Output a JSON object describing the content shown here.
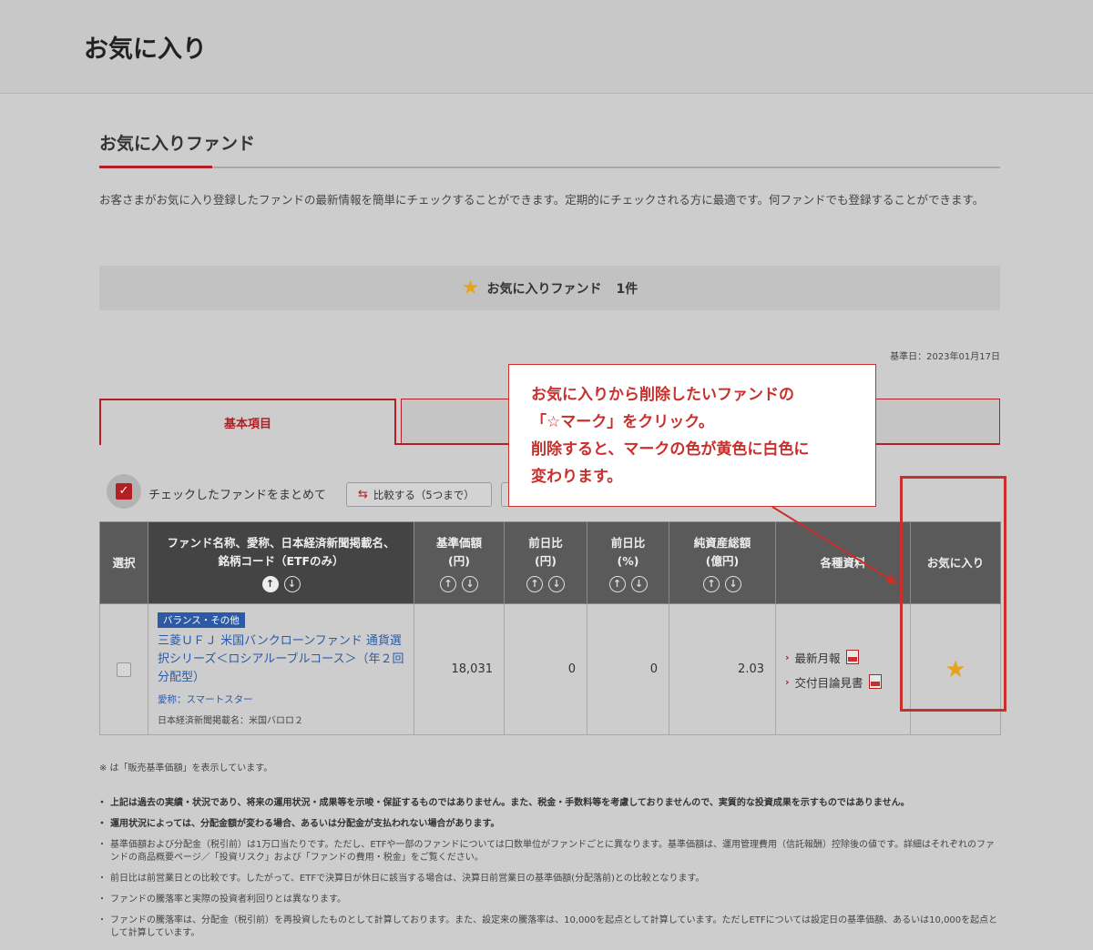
{
  "page": {
    "title": "お気に入り"
  },
  "section": {
    "title": "お気に入りファンド",
    "description": "お客さまがお気に入り登録したファンドの最新情報を簡単にチェックすることができます。定期的にチェックされる方に最適です。何ファンドでも登録することができます。"
  },
  "banner": {
    "label": "お気に入りファンド",
    "count": "1件",
    "icon": "star-icon",
    "star_color": "#e9a21c"
  },
  "base_date": "基準日：2023年01月17日",
  "tabs": [
    {
      "label": "基本項目",
      "active": true
    },
    {
      "label": "",
      "active": false
    }
  ],
  "actions": {
    "check_label": "チェックしたファンドをまとめて",
    "compare_label": "比較する（5つまで）"
  },
  "table": {
    "headers": {
      "select": "選択",
      "name_line1": "ファンド名称、愛称、日本経済新聞掲載名、",
      "name_line2": "銘柄コード（ETFのみ）",
      "nav_line1": "基準価額",
      "nav_line2": "(円)",
      "diff_yen_line1": "前日比",
      "diff_yen_line2": "(円)",
      "diff_pct_line1": "前日比",
      "diff_pct_line2": "(%)",
      "assets_line1": "純資産総額",
      "assets_line2": "(億円)",
      "docs": "各種資料",
      "favorite": "お気に入り"
    },
    "rows": [
      {
        "category": "バランス・その他",
        "name": "三菱ＵＦＪ 米国バンクローンファンド 通貨選択シリーズ＜ロシアルーブルコース＞（年２回分配型）",
        "nickname": "愛称：スマートスター",
        "newspaper_name": "日本経済新聞掲載名：米国バロロ２",
        "nav": "18,031",
        "diff_yen": "0",
        "diff_pct": "0",
        "assets": "2.03",
        "doc1": "最新月報",
        "doc2": "交付目論見書",
        "favorite": true
      }
    ]
  },
  "callout": {
    "line1": "お気に入りから削除したいファンドの",
    "line2": "「☆マーク」をクリック。",
    "line3": "削除すると、マークの色が黄色に白色に",
    "line4": "変わります。",
    "color": "#c9302c"
  },
  "notes": {
    "asterisk": "※ は「販売基準価額」を表示しています。",
    "items": [
      "上記は過去の実績・状況であり、将来の運用状況・成果等を示唆・保証するものではありません。また、税金・手数料等を考慮しておりませんので、実質的な投資成果を示すものではありません。",
      "運用状況によっては、分配金額が変わる場合、あるいは分配金が支払われない場合があります。",
      "基準価額および分配金（税引前）は1万口当たりです。ただし、ETFや一部のファンドについては口数単位がファンドごとに異なります。基準価額は、運用管理費用（信託報酬）控除後の値です。詳細はそれぞれのファンドの商品概要ページ／「投資リスク」および「ファンドの費用・税金」をご覧ください。",
      "前日比は前営業日との比較です。したがって、ETFで決算日が休日に該当する場合は、決算日前営業日の基準価額(分配落前)との比較となります。",
      "ファンドの騰落率と実際の投資者利回りとは異なります。",
      "ファンドの騰落率は、分配金（税引前）を再投資したものとして計算しております。また、設定来の騰落率は、10,000を起点として計算しています。ただしETFについては設定日の基準価額、あるいは10,000を起点として計算しています。"
    ]
  }
}
